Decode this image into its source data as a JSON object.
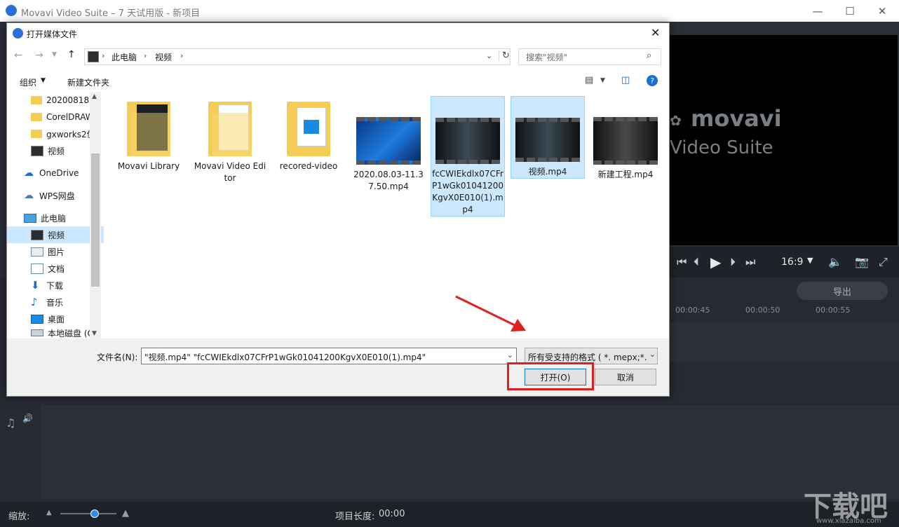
{
  "app": {
    "title": "Movavi Video Suite – 7 天试用版 - 新项目",
    "brand_line1": "movavi",
    "brand_line2": "Video Suite",
    "aspect": "16:9",
    "export_label": "导出",
    "ruler_ticks": [
      "00:00:45",
      "00:00:50",
      "00:00:55"
    ],
    "zoom_label": "缩放:",
    "project_length_label": "项目长度:",
    "project_length_value": "00:00",
    "watermark": "下载吧",
    "watermark_url": "www.xiazaiba.com"
  },
  "dialog": {
    "title": "打开媒体文件",
    "breadcrumb": [
      "此电脑",
      "视频"
    ],
    "search_placeholder": "搜索\"视频\"",
    "toolbar": {
      "organize": "组织",
      "new_folder": "新建文件夹"
    },
    "nav": [
      {
        "label": "20200818",
        "icon": "folder-icon"
      },
      {
        "label": "CorelDRAW",
        "icon": "folder-icon"
      },
      {
        "label": "gxworks2仿",
        "icon": "folder-icon"
      },
      {
        "label": "视频",
        "icon": "video-folder-icon"
      },
      {
        "label": "OneDrive",
        "icon": "cloud-icon"
      },
      {
        "label": "WPS网盘",
        "icon": "cloud-icon"
      },
      {
        "label": "此电脑",
        "icon": "computer-icon"
      },
      {
        "label": "视频",
        "icon": "video-folder-icon"
      },
      {
        "label": "图片",
        "icon": "pictures-icon"
      },
      {
        "label": "文档",
        "icon": "documents-icon"
      },
      {
        "label": "下载",
        "icon": "download-icon"
      },
      {
        "label": "音乐",
        "icon": "music-icon"
      },
      {
        "label": "桌面",
        "icon": "desktop-icon"
      },
      {
        "label": "本地磁盘 (C",
        "icon": "drive-icon"
      }
    ],
    "files": [
      {
        "name": "Movavi Library",
        "type": "folder"
      },
      {
        "name": "Movavi Video Editor",
        "type": "folder"
      },
      {
        "name": "recored-video",
        "type": "folder"
      },
      {
        "name": "2020.08.03-11.37.50.mp4",
        "type": "video"
      },
      {
        "name": "fcCWIEkdlx07CFrP1wGk01041200KgvX0E010(1).mp4",
        "type": "video"
      },
      {
        "name": "视频.mp4",
        "type": "video"
      },
      {
        "name": "新建工程.mp4",
        "type": "video"
      }
    ],
    "filename_label": "文件名(N):",
    "filename_value": "\"视频.mp4\" \"fcCWIEkdlx07CFrP1wGk01041200KgvX0E010(1).mp4\"",
    "filetype_value": "所有受支持的格式 ( *. mepx;*.",
    "open_label": "打开(O)",
    "cancel_label": "取消"
  },
  "colors": {
    "accent": "#0078d7",
    "highlight_red": "#e02020",
    "selection": "#cce8ff"
  }
}
